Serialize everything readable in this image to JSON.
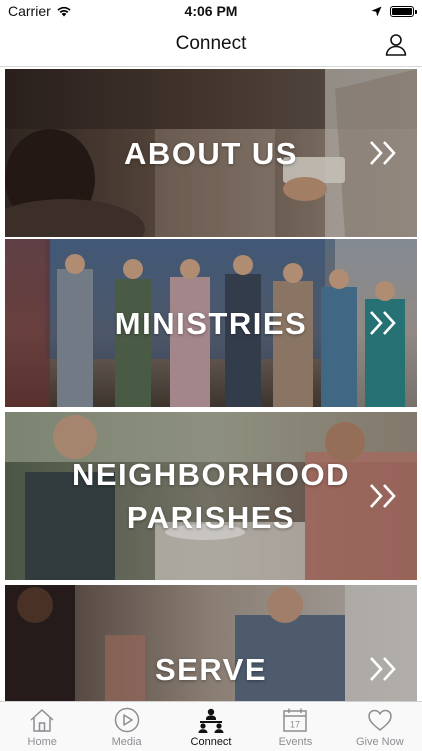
{
  "status_bar": {
    "carrier": "Carrier",
    "time": "4:06 PM",
    "wifi_icon": "wifi-icon",
    "location_icon": "location-arrow-icon",
    "battery_level": 1.0
  },
  "nav": {
    "title": "Connect",
    "profile_icon": "person-icon"
  },
  "cards": [
    {
      "label": "ABOUT US",
      "icon": "double-chevron-right-icon"
    },
    {
      "label": "MINISTRIES",
      "icon": "double-chevron-right-icon"
    },
    {
      "label": "NEIGHBORHOOD PARISHES",
      "icon": "double-chevron-right-icon"
    },
    {
      "label": "SERVE",
      "icon": "double-chevron-right-icon"
    }
  ],
  "tabs": [
    {
      "label": "Home",
      "icon": "house-icon",
      "active": false
    },
    {
      "label": "Media",
      "icon": "play-circle-icon",
      "active": false
    },
    {
      "label": "Connect",
      "icon": "people-icon",
      "active": true
    },
    {
      "label": "Events",
      "icon": "calendar-icon",
      "active": false,
      "calendar_day": "17"
    },
    {
      "label": "Give Now",
      "icon": "heart-icon",
      "active": false
    }
  ],
  "colors": {
    "tab_active": "#111111",
    "tab_inactive": "#8e8e93",
    "card_text": "#ffffff"
  }
}
